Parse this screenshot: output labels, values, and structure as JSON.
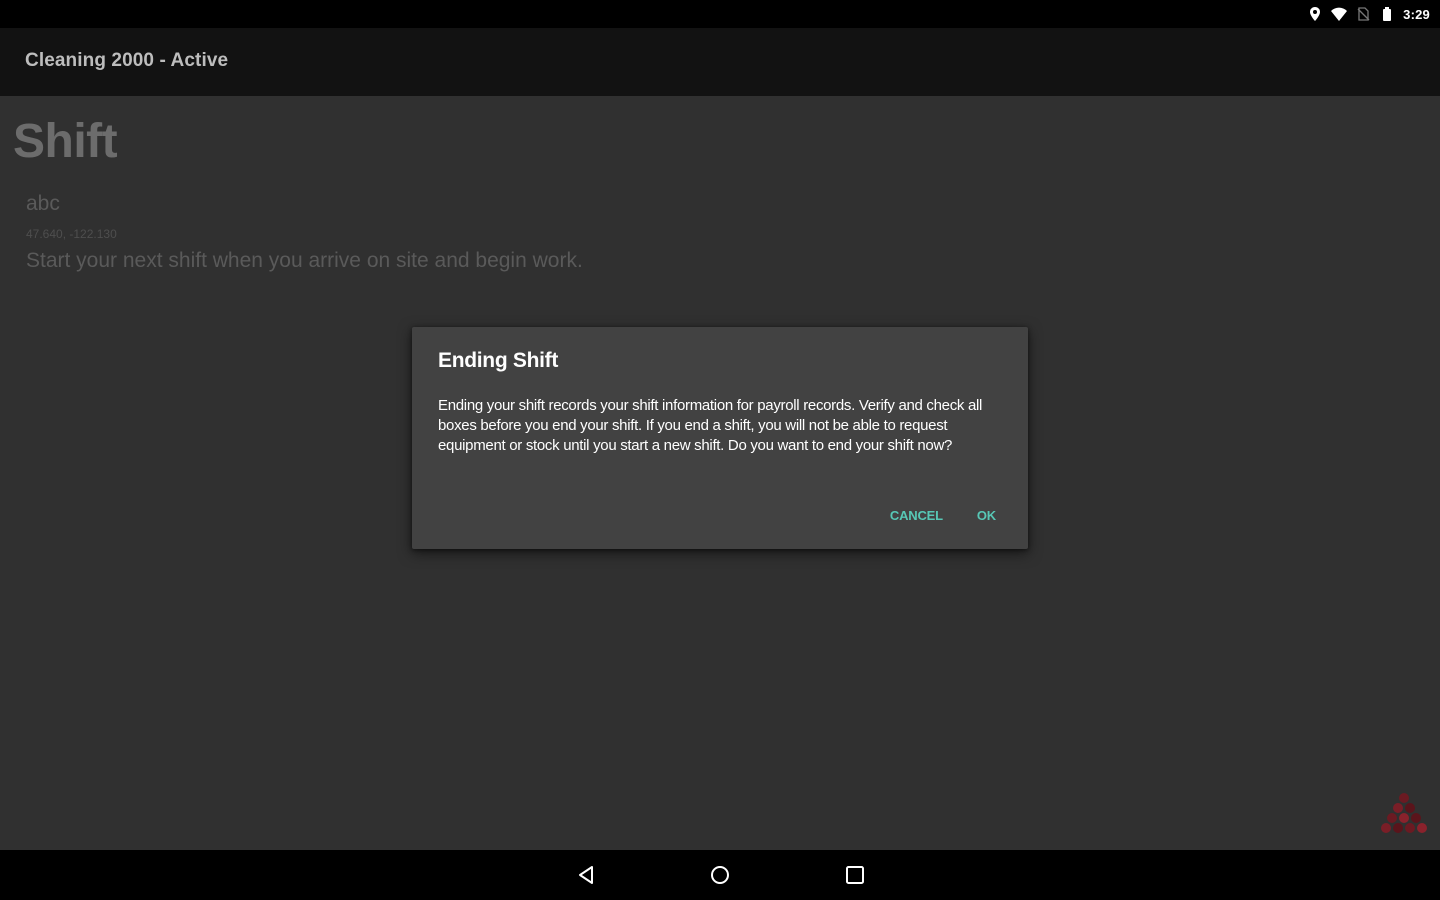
{
  "status_bar": {
    "time": "3:29",
    "icons": [
      "location-icon",
      "wifi-icon",
      "no-sim-icon",
      "battery-icon"
    ]
  },
  "app_bar": {
    "title": "Cleaning 2000 - Active"
  },
  "content": {
    "title": "Shift",
    "site_name": "abc",
    "coordinates": "47.640, -122.130",
    "hint": "Start your next shift when you arrive on site and begin work."
  },
  "dialog": {
    "title": "Ending Shift",
    "message": "Ending your shift records your shift information for payroll records. Verify and check all boxes before you end your shift. If you end a shift, you will not be able to request equipment or stock until you start a new shift. Do you want to end your shift now?",
    "cancel_label": "CANCEL",
    "ok_label": "OK"
  },
  "nav_bar": {
    "icons": [
      "back-icon",
      "home-icon",
      "recents-icon"
    ]
  },
  "colors": {
    "accent": "#57c7b5",
    "background": "#303030",
    "dialog": "#424242",
    "app_bar": "#121212"
  }
}
